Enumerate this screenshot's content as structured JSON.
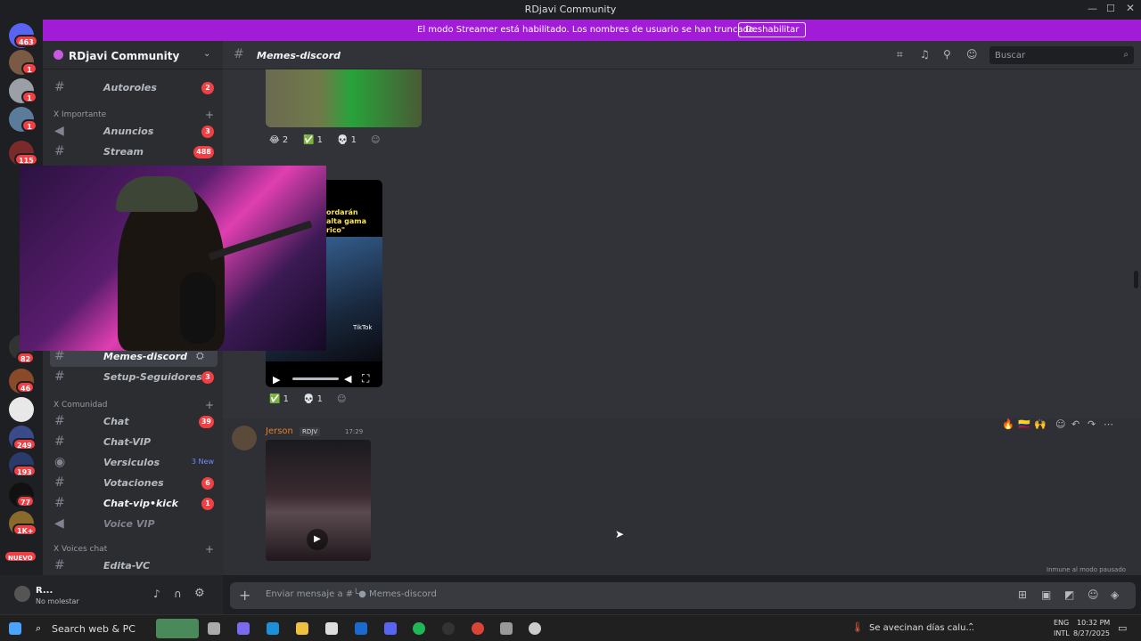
{
  "window": {
    "title": "RDjavi Community"
  },
  "banner": {
    "message": "El modo Streamer está habilitado. Los nombres de usuario se han truncado.",
    "button": "Deshabilitar"
  },
  "guild_badges": [
    "463",
    "1",
    "1",
    "1",
    "115",
    "82",
    "46",
    "249",
    "193",
    "77",
    "1K+",
    "NUEVO"
  ],
  "sidebar": {
    "server_name": "RDjavi Community",
    "channels_top": [
      {
        "label": "Autoroles",
        "count": "2"
      }
    ],
    "cat_importante": "X Importante",
    "channels_imp": [
      {
        "label": "Anuncios",
        "count": "3"
      },
      {
        "label": "Stream",
        "count": "488"
      }
    ],
    "channels_mid": [
      {
        "label": "Memes-discord",
        "count": ""
      },
      {
        "label": "Setup-Seguidores",
        "count": "3"
      }
    ],
    "cat_comunidad": "X Comunidad",
    "channels_com": [
      {
        "label": "Chat",
        "count": "39"
      },
      {
        "label": "Chat-VIP",
        "count": ""
      },
      {
        "label": "Versiculos",
        "count": "3 New"
      },
      {
        "label": "Votaciones",
        "count": "6"
      },
      {
        "label": "Chat-vip•kick",
        "count": "1"
      },
      {
        "label": "Voice VIP",
        "count": ""
      }
    ],
    "cat_voices": "X Voices chat",
    "channels_voice": [
      {
        "label": "Edita-VC",
        "count": ""
      }
    ]
  },
  "user": {
    "name": "R...",
    "status": "No molestar"
  },
  "header": {
    "channel": "Memes-discord",
    "search_placeholder": "Buscar"
  },
  "chat": {
    "reactions1": [
      "2",
      "1",
      "1"
    ],
    "reactions2": [
      "1",
      "1"
    ],
    "author": "Jerson",
    "role_tag": "RDJV",
    "time": "17:29",
    "tiktok_label": "TikTok",
    "video_text": "ordarán\nalta gama\nrico\"",
    "immune_note": "Inmune al modo pausado"
  },
  "composer": {
    "placeholder": "Enviar mensaje a #╰● Memes-discord"
  },
  "taskbar": {
    "search": "Search web & PC",
    "weather": "Se avecinan días calu...",
    "lang1": "ENG",
    "lang2": "INTL",
    "time": "10:32 PM",
    "date": "8/27/2025"
  },
  "colors": {
    "accent": "#a21cd8",
    "badge": "#f23f43",
    "bg": "#313338"
  }
}
